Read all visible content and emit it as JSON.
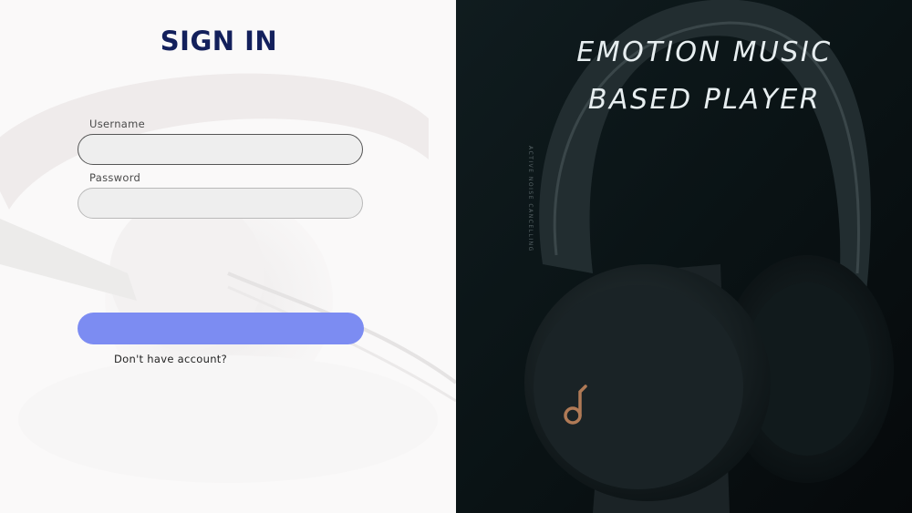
{
  "login": {
    "title": "SIGN IN",
    "username_label": "Username",
    "username_value": "",
    "password_label": "Password",
    "password_value": "",
    "submit_label": "",
    "no_account_text": "Don't have account?"
  },
  "hero": {
    "headline_line1": "EMOTION MUSIC",
    "headline_line2": "BASED PLAYER",
    "side_text": "ACTIVE NOISE CANCELLING"
  },
  "colors": {
    "title": "#13205c",
    "button": "#7c8cf2",
    "input_bg": "#eeeeee",
    "right_bg": "#0a1416",
    "logo_accent": "#b07a56"
  }
}
